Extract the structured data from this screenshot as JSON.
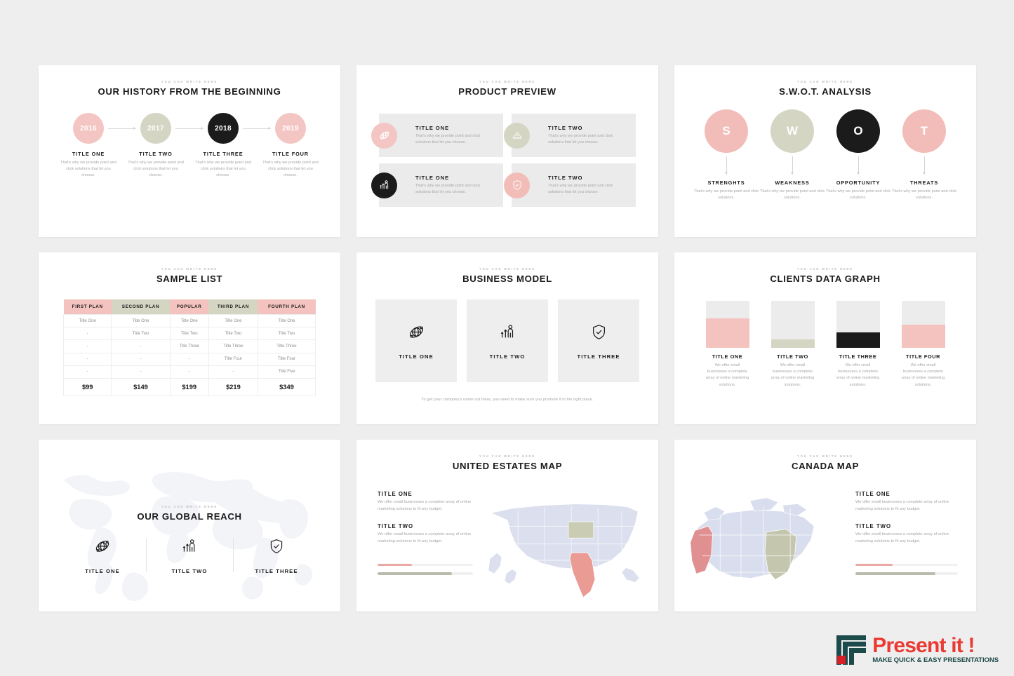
{
  "eyebrow": "YOU CAN WRITE HERE",
  "colors": {
    "pink": "#f3c6c3",
    "pink_strong": "#f2bdb8",
    "sage": "#d4d5c3",
    "black": "#1b1b1b",
    "grey_panel": "#ebebeb",
    "logo_red": "#ea3a34",
    "logo_teal": "#1d4a4a"
  },
  "slides": {
    "history": {
      "title": "OUR HISTORY FROM THE BEGINNING",
      "items": [
        {
          "year": "2016",
          "name": "TITLE ONE",
          "desc": "That's why we provide point and click solutions that let you choose.",
          "color": "pink"
        },
        {
          "year": "2017",
          "name": "TITLE TWO",
          "desc": "That's why we provide point and click solutions that let you choose.",
          "color": "sage"
        },
        {
          "year": "2018",
          "name": "TITLE THREE",
          "desc": "That's why we provide point and click solutions that let you choose.",
          "color": "black"
        },
        {
          "year": "2019",
          "name": "TITLE FOUR",
          "desc": "That's why we provide point and click solutions that let you choose.",
          "color": "pink"
        }
      ]
    },
    "product_preview": {
      "title": "PRODUCT PREVIEW",
      "cards": [
        {
          "title": "TITLE ONE",
          "desc": "That's why we provide point and click solutions that let you choose.",
          "icon": "globe-icon",
          "color": "pink"
        },
        {
          "title": "TITLE TWO",
          "desc": "That's why we provide point and click solutions that let you choose.",
          "icon": "presentation-icon",
          "color": "sage"
        },
        {
          "title": "TITLE ONE",
          "desc": "That's why we provide point and click solutions that let you choose.",
          "icon": "growth-person-icon",
          "color": "black"
        },
        {
          "title": "TITLE TWO",
          "desc": "That's why we provide point and click solutions that let you choose.",
          "icon": "shield-check-icon",
          "color": "pink"
        }
      ]
    },
    "swot": {
      "title": "S.W.O.T. ANALYSIS",
      "items": [
        {
          "letter": "S",
          "name": "STRENGHTS",
          "desc": "That's why we provide point and click solutions.",
          "color": "pink"
        },
        {
          "letter": "W",
          "name": "WEAKNESS",
          "desc": "That's why we provide point and click solutions.",
          "color": "sage"
        },
        {
          "letter": "O",
          "name": "OPPORTUNITY",
          "desc": "That's why we provide point and click solutions.",
          "color": "black"
        },
        {
          "letter": "T",
          "name": "THREATS",
          "desc": "That's why we provide point and click solutions.",
          "color": "pink"
        }
      ]
    },
    "sample_list": {
      "title": "SAMPLE LIST",
      "headers": [
        "FIRST PLAN",
        "SECOND PLAN",
        "POPULAR",
        "THIRD PLAN",
        "FOURTH PLAN"
      ],
      "header_colors": [
        "pink",
        "sage",
        "pink",
        "sage",
        "pink"
      ],
      "rows": [
        [
          "Title One",
          "Title One",
          "Title One",
          "Title One",
          "Title One"
        ],
        [
          "-",
          "Title Two",
          "Title Two",
          "Title Two",
          "Title Two"
        ],
        [
          "-",
          "-",
          "Title Three",
          "Title Three",
          "Title Three"
        ],
        [
          "-",
          "-",
          "-",
          "Title Four",
          "Title Four"
        ],
        [
          "-",
          "-",
          "-",
          "-",
          "Title Five"
        ]
      ],
      "prices": [
        "$99",
        "$149",
        "$199",
        "$219",
        "$349"
      ]
    },
    "business_model": {
      "title": "BUSINESS MODEL",
      "cards": [
        {
          "title": "TITLE ONE",
          "icon": "globe-icon"
        },
        {
          "title": "TITLE TWO",
          "icon": "growth-person-icon"
        },
        {
          "title": "TITLE THREE",
          "icon": "shield-check-icon"
        }
      ],
      "footer": "To get your company's name out there, you need to make sure you promote it in the right place."
    },
    "clients_graph": {
      "title": "CLIENTS DATA GRAPH",
      "items": [
        {
          "name": "TITLE ONE",
          "desc": "We offer small businesses a complete array of online marketing solutions.",
          "value": 63,
          "color": "pink"
        },
        {
          "name": "TITLE TWO",
          "desc": "We offer small businesses a complete array of online marketing solutions.",
          "value": 18,
          "color": "sage"
        },
        {
          "name": "TITLE THREE",
          "desc": "We offer small businesses a complete array of online marketing solutions.",
          "value": 33,
          "color": "black"
        },
        {
          "name": "TITLE FOUR",
          "desc": "We offer small businesses a complete array of online marketing solutions.",
          "value": 50,
          "color": "pink"
        }
      ]
    },
    "global_reach": {
      "title": "OUR GLOBAL REACH",
      "items": [
        {
          "title": "TITLE ONE",
          "icon": "globe-icon"
        },
        {
          "title": "TITLE TWO",
          "icon": "growth-person-icon"
        },
        {
          "title": "TITLE THREE",
          "icon": "shield-check-icon"
        }
      ]
    },
    "us_map": {
      "title": "UNITED ESTATES MAP",
      "blocks": [
        {
          "title": "TITLE ONE",
          "desc": "We offer small businesses a complete array of online marketing solutions to fit any budget."
        },
        {
          "title": "TITLE TWO",
          "desc": "We offer small businesses a complete array of online marketing solutions to fit any budget."
        }
      ],
      "progress": [
        {
          "value": 36,
          "color": "pink"
        },
        {
          "value": 78,
          "color": "sage"
        }
      ]
    },
    "canada_map": {
      "title": "CANADA MAP",
      "blocks": [
        {
          "title": "TITLE ONE",
          "desc": "We offer small businesses a complete array of online marketing solutions to fit any budget."
        },
        {
          "title": "TITLE TWO",
          "desc": "We offer small businesses a complete array of online marketing solutions to fit any budget."
        }
      ],
      "progress": [
        {
          "value": 36,
          "color": "pink"
        },
        {
          "value": 78,
          "color": "sage"
        }
      ]
    }
  },
  "logo": {
    "word": "Present it !",
    "tagline": "MAKE QUICK & EASY PRESENTATIONS"
  }
}
